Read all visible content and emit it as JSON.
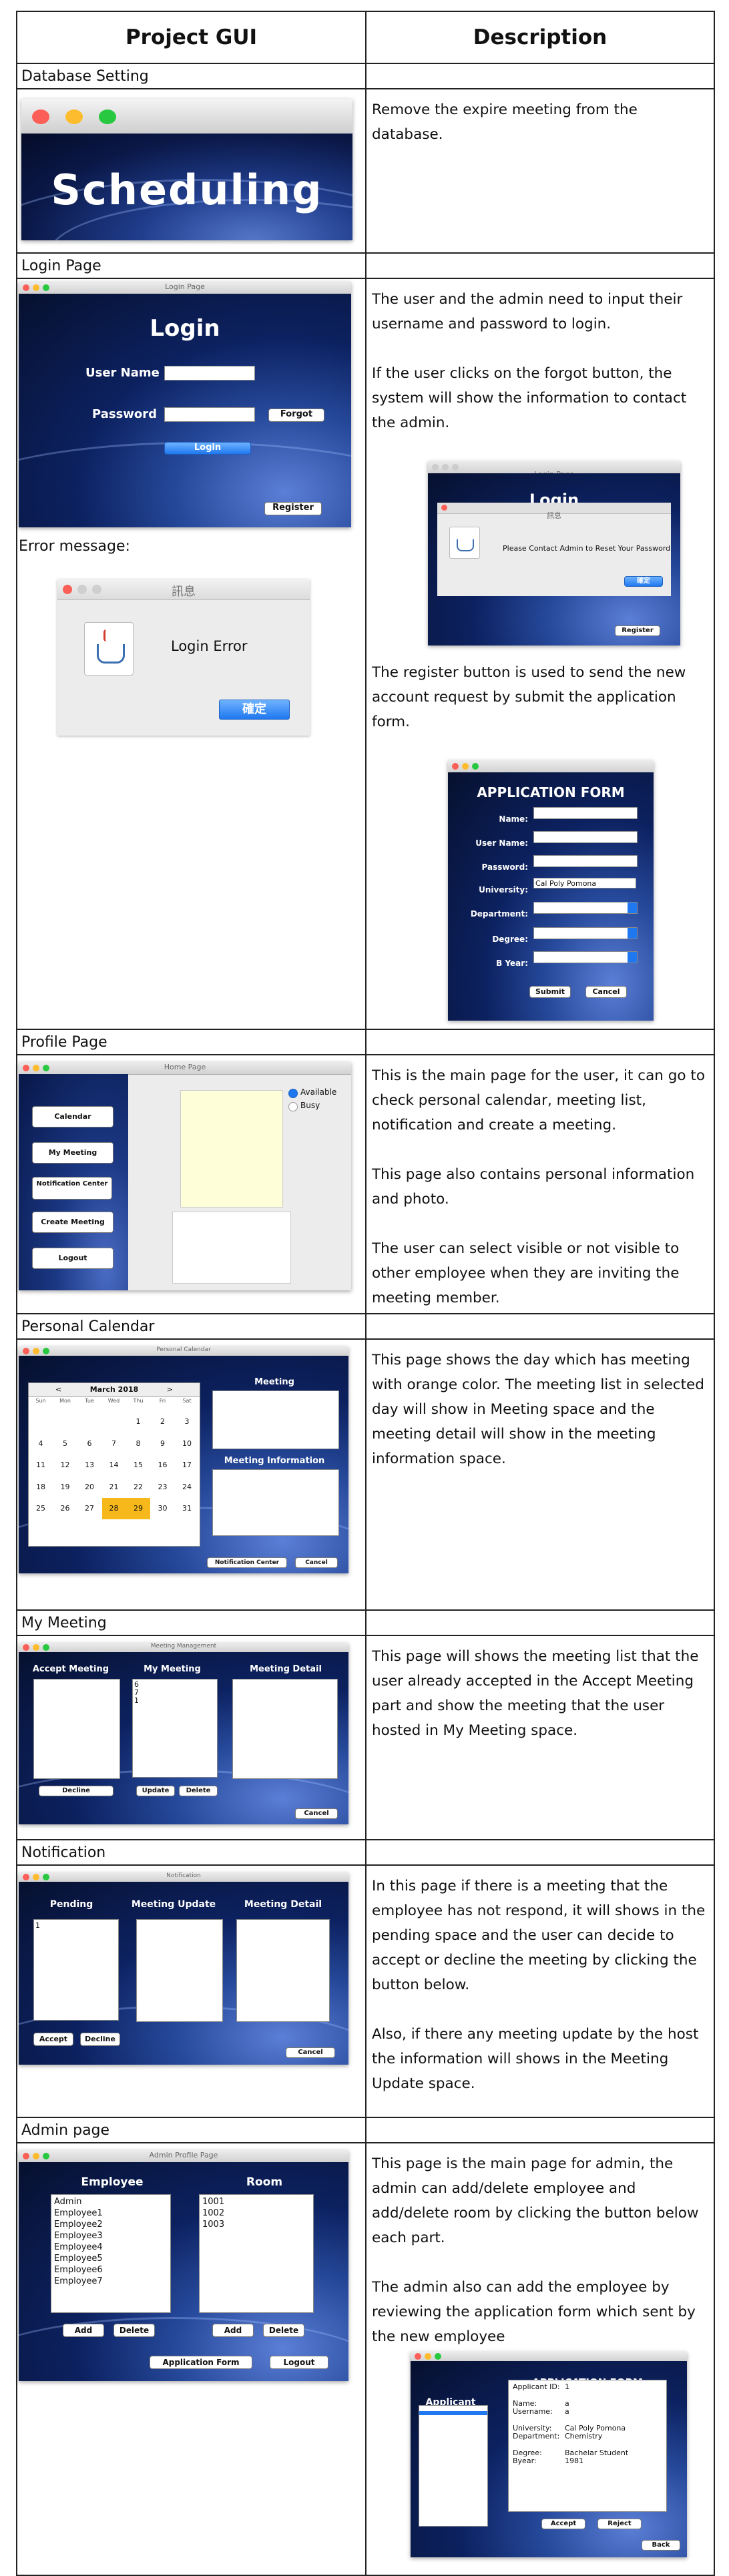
{
  "table": {
    "col_gui": "Project GUI",
    "col_desc": "Description"
  },
  "sections": {
    "database": {
      "title": "Database Setting",
      "splash_text": "Scheduling",
      "desc": [
        "Remove the expire meeting from the database."
      ]
    },
    "login": {
      "title": "Login Page",
      "window_title": "Login Page",
      "heading": "Login",
      "user_label": "User Name",
      "password_label": "Password",
      "forgot_btn": "Forgot",
      "login_btn": "Login",
      "register_btn": "Register",
      "error_caption": "Error message:",
      "error_title": "訊息",
      "error_text": "Login Error",
      "error_ok": "確定",
      "desc": [
        "The user and the admin need to input their username and password to login.",
        "If the user clicks on the forgot button, the system will show the information to contact the admin.",
        "The register button is used to send the new account request by submit the application form."
      ],
      "forgot_dialog_title": "訊息",
      "forgot_dialog_text": "Please Contact Admin to Reset Your Password",
      "forgot_dialog_ok": "確定",
      "app_form": {
        "title": "APPLICATION FORM",
        "name": "Name:",
        "user_name": "User Name:",
        "password": "Password:",
        "university": "University:",
        "university_value": "Cal Poly Pomona",
        "department": "Department:",
        "degree": "Degree:",
        "year": "B Year:",
        "submit": "Submit",
        "cancel": "Cancel"
      }
    },
    "profile": {
      "title": "Profile Page",
      "window_title": "Home Page",
      "buttons": [
        "Calendar",
        "My Meeting",
        "Notification Center",
        "Create Meeting",
        "Logout"
      ],
      "available": "Available",
      "busy": "Busy",
      "desc": [
        "This is the main page for the user, it can go to check personal calendar, meeting list, notification and create a meeting.",
        "This page also contains personal information and photo.",
        "The user can select visible or not visible to other employee when they are inviting the meeting member."
      ]
    },
    "calendar": {
      "title": "Personal Calendar",
      "window_title": "Personal Calendar",
      "month": "March 2018",
      "prev": "<",
      "next": ">",
      "days": [
        "Sun",
        "Mon",
        "Tue",
        "Wed",
        "Thu",
        "Fri",
        "Sat"
      ],
      "weeks": [
        [
          "",
          "",
          "",
          "",
          "1",
          "2",
          "3"
        ],
        [
          "4",
          "5",
          "6",
          "7",
          "8",
          "9",
          "10"
        ],
        [
          "11",
          "12",
          "13",
          "14",
          "15",
          "16",
          "17"
        ],
        [
          "18",
          "19",
          "20",
          "21",
          "22",
          "23",
          "24"
        ],
        [
          "25",
          "26",
          "27",
          "28",
          "29",
          "30",
          "31"
        ]
      ],
      "highlighted": [
        "28",
        "29"
      ],
      "meeting_label": "Meeting",
      "meeting_info_label": "Meeting Information",
      "notif_btn": "Notification Center",
      "cancel_btn": "Cancel",
      "desc": [
        "This page shows the day which has meeting with orange color. The meeting list in selected day will show in Meeting space and the meeting detail will show in the meeting information space."
      ]
    },
    "mymeeting": {
      "title": "My Meeting",
      "window_title": "Meeting Management",
      "accept_label": "Accept Meeting",
      "my_label": "My Meeting",
      "detail_label": "Meeting Detail",
      "list_items": [
        "6",
        "7",
        "1"
      ],
      "decline_btn": "Decline",
      "update_btn": "Update",
      "delete_btn": "Delete",
      "cancel_btn": "Cancel",
      "desc": [
        "This page will shows the meeting list that the user already accepted in the Accept Meeting part and show the meeting that the user hosted in My Meeting space."
      ]
    },
    "notification": {
      "title": "Notification",
      "window_title": "Notification",
      "pending_label": "Pending",
      "update_label": "Meeting Update",
      "detail_label": "Meeting Detail",
      "list_items": [
        "1"
      ],
      "accept_btn": "Accept",
      "decline_btn": "Decline",
      "cancel_btn": "Cancel",
      "desc": [
        "In this page if there is a meeting that the employee has not respond, it will shows in the pending space and the user can decide to accept or decline the meeting by clicking the button below.",
        "Also, if there any meeting update by the host the information will shows in the Meeting Update space."
      ]
    },
    "admin": {
      "title": "Admin page",
      "window_title": "Admin Profile Page",
      "employee_label": "Employee",
      "room_label": "Room",
      "employees": [
        "Admin",
        "Employee1",
        "Employee2",
        "Employee3",
        "Employee4",
        "Employee5",
        "Employee6",
        "Employee7"
      ],
      "rooms": [
        "1001",
        "1002",
        "1003"
      ],
      "add_btn": "Add",
      "delete_btn": "Delete",
      "app_form_btn": "Application Form",
      "logout_btn": "Logout",
      "desc": [
        "This page is the main page for admin, the admin can add/delete employee and add/delete room by clicking the button below each part.",
        "The admin also can add the employee by reviewing the application form which sent by the new employee"
      ],
      "review": {
        "title": "APPLICATION FORM",
        "applicant": "Applicant",
        "lines": [
          [
            "Applicant ID:",
            "1"
          ],
          [
            "Name:",
            "a"
          ],
          [
            "Username:",
            "a"
          ],
          [
            "University:",
            "Cal Poly Pomona"
          ],
          [
            "Department:",
            "Chemistry"
          ],
          [
            "Degree:",
            "Bachelar Student"
          ],
          [
            "Byear:",
            "1981"
          ]
        ],
        "accept": "Accept",
        "reject": "Reject",
        "back": "Back"
      }
    }
  }
}
